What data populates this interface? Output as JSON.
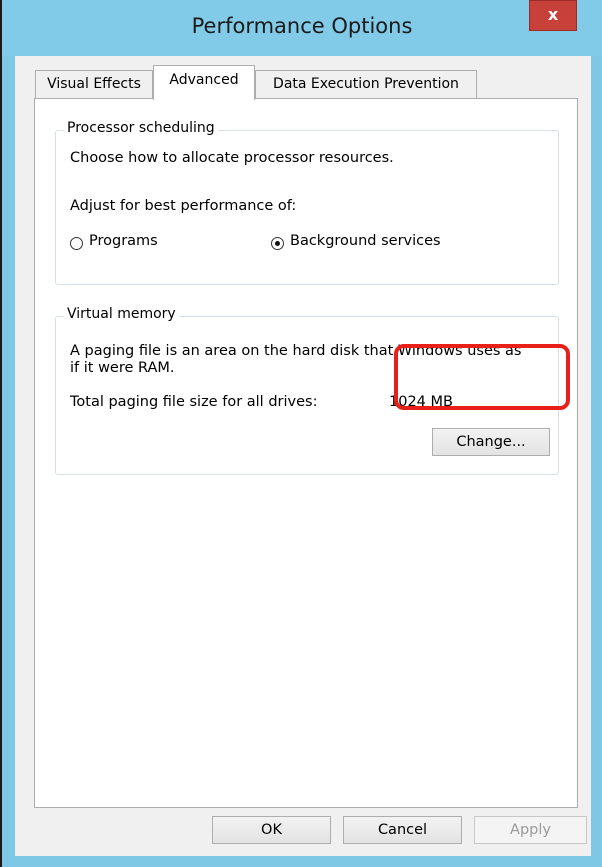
{
  "window": {
    "title": "Performance Options",
    "close_label": "x"
  },
  "tabs": [
    {
      "label": "Visual Effects",
      "active": false
    },
    {
      "label": "Advanced",
      "active": true
    },
    {
      "label": "Data Execution Prevention",
      "active": false
    }
  ],
  "processor_scheduling": {
    "group_label": "Processor scheduling",
    "description": "Choose how to allocate processor resources.",
    "adjust_label": "Adjust for best performance of:",
    "options": [
      {
        "label": "Programs",
        "selected": false
      },
      {
        "label": "Background services",
        "selected": true
      }
    ]
  },
  "virtual_memory": {
    "group_label": "Virtual memory",
    "description_line1": "A paging file is an area on the hard disk that Windows uses as",
    "description_line2": "if it were RAM.",
    "total_label": "Total paging file size for all drives:",
    "total_value": "1024 MB",
    "change_button": "Change..."
  },
  "footer": {
    "ok": "OK",
    "cancel": "Cancel",
    "apply": "Apply"
  },
  "colors": {
    "title_bar": "#82cbe8",
    "close_button": "#c7413a",
    "highlight": "#e8201a"
  }
}
